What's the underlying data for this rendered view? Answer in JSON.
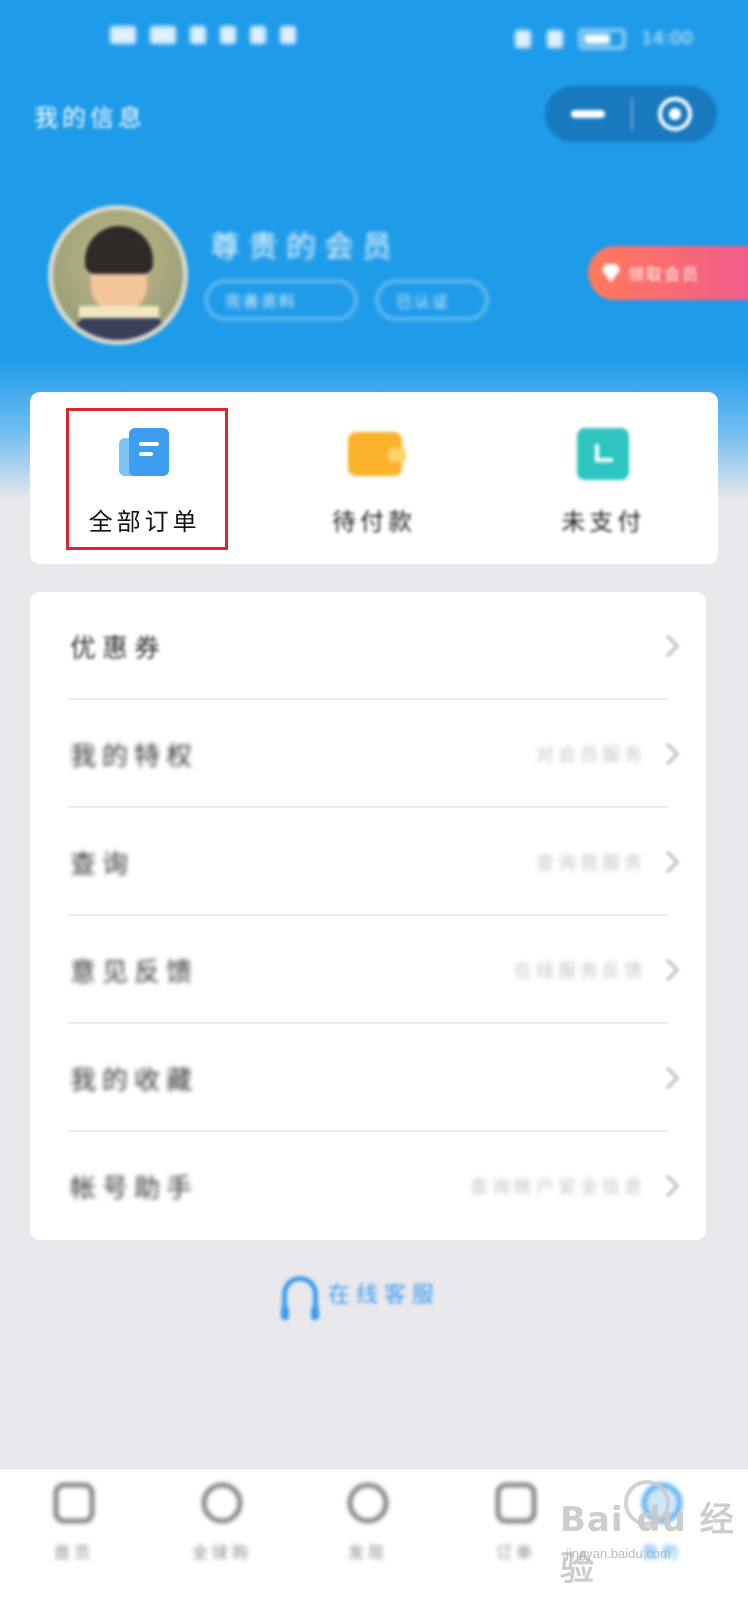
{
  "status_bar": {
    "time": "14:00"
  },
  "nav": {
    "title": "我的信息"
  },
  "profile": {
    "nickname": "尊贵的会员",
    "pill_1": "完善资料",
    "pill_2": "已认证",
    "member_button": "领取会员"
  },
  "orders": [
    {
      "label": "全部订单",
      "icon": "document-icon"
    },
    {
      "label": "待付款",
      "icon": "wallet-icon"
    },
    {
      "label": "未支付",
      "icon": "clock-icon"
    }
  ],
  "menu": [
    {
      "label": "优惠券",
      "sub": ""
    },
    {
      "label": "我的特权",
      "sub": "对会员服务"
    },
    {
      "label": "查询",
      "sub": "查询我服务"
    },
    {
      "label": "意见反馈",
      "sub": "在线服务反馈"
    },
    {
      "label": "我的收藏",
      "sub": ""
    },
    {
      "label": "帐号助手",
      "sub": "查询帐户安全信息"
    }
  ],
  "service": {
    "label": "在线客服"
  },
  "tabbar": [
    {
      "label": "首页",
      "icon": "home-icon"
    },
    {
      "label": "全球购",
      "icon": "globe-icon"
    },
    {
      "label": "发现",
      "icon": "discover-icon"
    },
    {
      "label": "订单",
      "icon": "calendar-icon"
    },
    {
      "label": "我的",
      "icon": "user-icon"
    }
  ],
  "watermark": {
    "brand": "Bai du 经验",
    "url": "jingyan.baidu.com"
  },
  "colors": {
    "header_blue": "#1e9be9",
    "accent_blue": "#3d9df1",
    "highlight_red": "#d9272e",
    "member_gradient_start": "#ff7a5a",
    "member_gradient_end": "#f25a8e"
  }
}
